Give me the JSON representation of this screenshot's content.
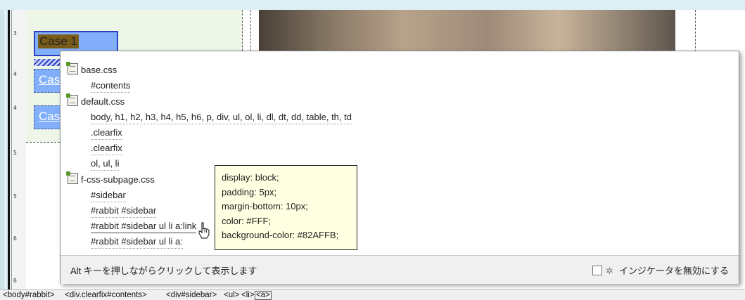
{
  "ruler": {
    "numbers": [
      "3",
      "4",
      "4",
      "5",
      "5",
      "6",
      "6"
    ]
  },
  "design_view": {
    "sidebar_items": [
      {
        "label": "Case 1",
        "selected": true
      },
      {
        "label": "Cas",
        "selected": false
      },
      {
        "label": "Cas",
        "selected": false
      }
    ]
  },
  "code_navigator": {
    "files": [
      {
        "name": "base.css",
        "rules": [
          "#contents"
        ]
      },
      {
        "name": "default.css",
        "rules": [
          "body, h1, h2, h3, h4, h5, h6, p, div, ul, ol, li, dl, dt, dd, table, th, td",
          ".clearfix",
          ".clearfix",
          "ol, ul, li"
        ]
      },
      {
        "name": "f-css-subpage.css",
        "rules": [
          "#sidebar",
          "#rabbit #sidebar",
          "#rabbit #sidebar ul li a:link",
          "#rabbit #sidebar ul li a:"
        ]
      }
    ],
    "tooltip": [
      "display: block;",
      "padding: 5px;",
      "margin-bottom: 10px;",
      "color: #FFF;",
      "background-color: #82AFFB;"
    ],
    "footer_hint": "Alt キーを押しながらクリックして表示します",
    "disable_indicator_label": "インジケータを無効にする"
  },
  "tag_selector": [
    "<body#rabbit>",
    "<div.clearfix#contents>",
    "<div#sidebar>",
    "<ul>",
    "<li>",
    "<a>"
  ],
  "colors": {
    "case_bg": "#82affb",
    "tooltip_bg": "#ffffe1",
    "selection_border": "#2a3fbf"
  }
}
